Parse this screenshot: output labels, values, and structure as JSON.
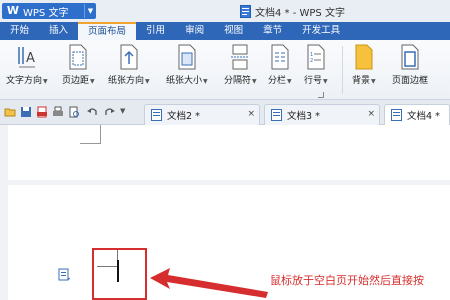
{
  "titlebar": {
    "app_name": "WPS 文字",
    "document_title": "文档4 * - WPS 文字"
  },
  "ribbon_tabs": [
    {
      "label": "开始"
    },
    {
      "label": "插入"
    },
    {
      "label": "页面布局",
      "active": true
    },
    {
      "label": "引用"
    },
    {
      "label": "审阅"
    },
    {
      "label": "视图"
    },
    {
      "label": "章节"
    },
    {
      "label": "开发工具"
    }
  ],
  "ribbon": {
    "text_direction": "文字方向",
    "margins": "页边距",
    "orientation": "纸张方向",
    "paper_size": "纸张大小",
    "breaks": "分隔符",
    "columns": "分栏",
    "line_numbers": "行号",
    "background": "背景",
    "page_border": "页面边框"
  },
  "doc_tabs": [
    {
      "label": "文档2 *"
    },
    {
      "label": "文档3 *"
    },
    {
      "label": "文档4 *",
      "active": true
    }
  ],
  "annotation": {
    "text": "鼠标放于空白页开始然后直接按",
    "color": "#d62e2e"
  },
  "colors": {
    "tab_bar": "#2e66b8",
    "accent": "#f0a530",
    "highlight": "#d62e2e"
  }
}
